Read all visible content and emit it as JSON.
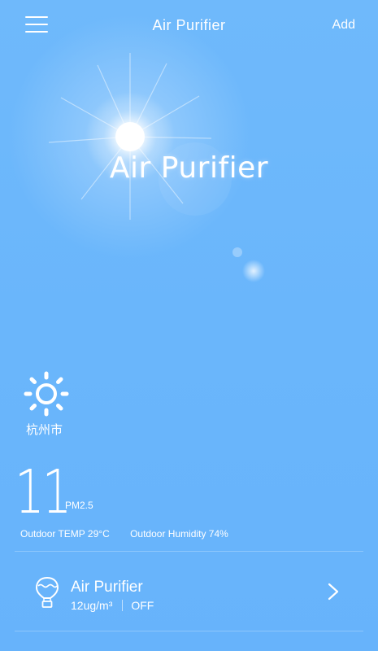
{
  "topbar": {
    "menu_icon": "menu-icon",
    "title": "Air Purifier",
    "add_label": "Add"
  },
  "hero": {
    "title": "Air Purifier"
  },
  "weather": {
    "icon": "sun-icon",
    "city": "杭州市"
  },
  "air": {
    "pm_value": "11",
    "pm_label": "PM2.5",
    "outdoor_temp": "Outdoor TEMP 29°C",
    "outdoor_humidity": "Outdoor Humidity 74%"
  },
  "devices": [
    {
      "icon": "balloon-icon",
      "name": "Air Purifier",
      "reading": "12ug/m³",
      "status": "OFF"
    }
  ]
}
